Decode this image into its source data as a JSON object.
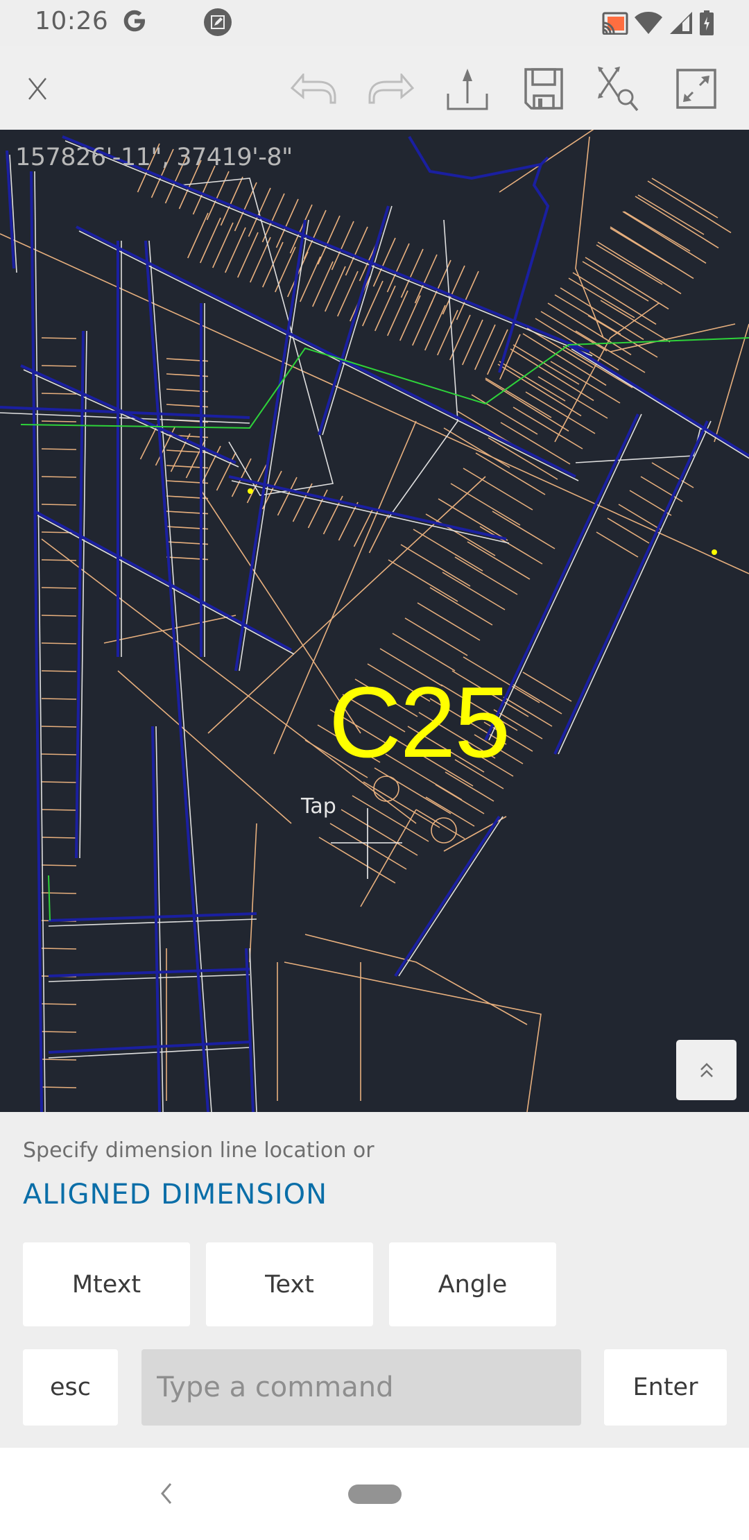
{
  "status_bar": {
    "time": "10:26",
    "left_icons": [
      "google-g-icon",
      "screenshot-edit-icon"
    ],
    "right_icons": [
      "cast-icon",
      "wifi-icon",
      "cellular-signal-icon",
      "battery-charging-icon"
    ],
    "cast_color": "#ff6e40"
  },
  "toolbar": {
    "close_label": "Close",
    "undo_label": "Undo",
    "redo_label": "Redo",
    "share_label": "Share",
    "save_label": "Save",
    "zoom_extents_label": "Zoom extents",
    "fullscreen_label": "Fullscreen",
    "undo_enabled": false,
    "redo_enabled": false
  },
  "canvas": {
    "background": "#212630",
    "coordinates": "157826'-11\", 37419'-8\"",
    "sheet_label": "C25",
    "sheet_label_color": "#ffff00",
    "cursor_hint": "Tap",
    "layer_colors": {
      "parcels": "#e8b07e",
      "pipes": "#1a1fa0",
      "centerlines": "#e8e8e8",
      "green_line": "#2ed33a",
      "markers": "#ffff00"
    },
    "collapse_button_label": "Expand panel"
  },
  "command_panel": {
    "prompt": "Specify dimension line location or",
    "command": "ALIGNED DIMENSION",
    "command_color": "#0a6ea8",
    "options": [
      {
        "label": "Mtext"
      },
      {
        "label": "Text"
      },
      {
        "label": "Angle"
      }
    ],
    "esc_label": "esc",
    "input_placeholder": "Type a command",
    "input_value": "",
    "enter_label": "Enter"
  },
  "nav_bar": {
    "back_label": "Back",
    "home_label": "Home"
  }
}
